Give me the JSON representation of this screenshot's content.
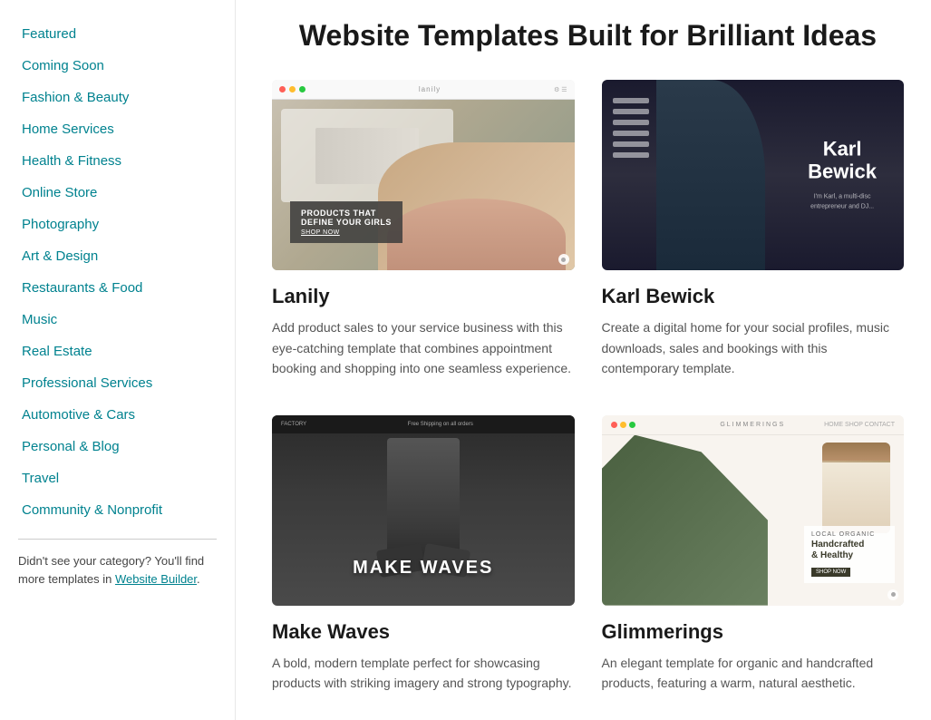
{
  "page": {
    "title": "Website Templates Built for Brilliant Ideas"
  },
  "sidebar": {
    "items": [
      {
        "id": "featured",
        "label": "Featured"
      },
      {
        "id": "coming-soon",
        "label": "Coming Soon"
      },
      {
        "id": "fashion-beauty",
        "label": "Fashion & Beauty"
      },
      {
        "id": "home-services",
        "label": "Home Services"
      },
      {
        "id": "health-fitness",
        "label": "Health & Fitness"
      },
      {
        "id": "online-store",
        "label": "Online Store"
      },
      {
        "id": "photography",
        "label": "Photography"
      },
      {
        "id": "art-design",
        "label": "Art & Design"
      },
      {
        "id": "restaurants-food",
        "label": "Restaurants & Food"
      },
      {
        "id": "music",
        "label": "Music"
      },
      {
        "id": "real-estate",
        "label": "Real Estate"
      },
      {
        "id": "professional-services",
        "label": "Professional Services"
      },
      {
        "id": "automotive-cars",
        "label": "Automotive & Cars"
      },
      {
        "id": "personal-blog",
        "label": "Personal & Blog"
      },
      {
        "id": "travel",
        "label": "Travel"
      },
      {
        "id": "community-nonprofit",
        "label": "Community & Nonprofit"
      }
    ],
    "footer_text": "Didn't see your category? You'll find more templates in Website Builder.",
    "footer_link": "Website Builder"
  },
  "templates": [
    {
      "id": "lanily",
      "name": "Lanily",
      "description": "Add product sales to your service business with this eye-catching template that combines appointment booking and shopping into one seamless experience.",
      "theme": "lanily"
    },
    {
      "id": "karl-bewick",
      "name": "Karl Bewick",
      "description": "Create a digital home for your social profiles, music downloads, sales and bookings with this contemporary template.",
      "theme": "karl"
    },
    {
      "id": "factory",
      "name": "Make Waves",
      "description": "A bold, modern template perfect for showcasing products with striking imagery and strong typography.",
      "theme": "factory"
    },
    {
      "id": "glimmerings",
      "name": "Glimmerings",
      "description": "An elegant template for organic and handcrafted products, featuring a warm, natural aesthetic.",
      "theme": "glimmerings"
    }
  ],
  "product_banner": {
    "line1": "PRODUCTS THAT",
    "line2": "DEFINE YOUR GIRLS",
    "cta": "SHOP NOW"
  },
  "karl": {
    "name_line1": "Karl",
    "name_line2": "Bewick",
    "subtitle": "I'm Karl, a multi-disc\nentrepreneur and DJ..."
  },
  "make_waves": {
    "text": "MAKE WAVES"
  },
  "glimmerings": {
    "brand": "GLIMMERINGS",
    "tagline1": "Handcrafted",
    "tagline2": "& Healthy",
    "sub": "SHOP NOW"
  }
}
